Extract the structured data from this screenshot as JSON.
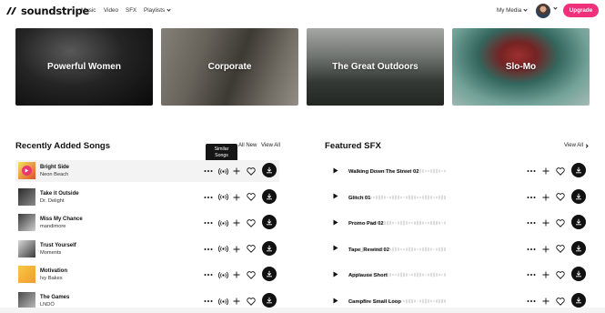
{
  "nav": {
    "brand": "soundstripe",
    "links": [
      "Music",
      "Video",
      "SFX",
      "Playlists"
    ],
    "my_media": "My Media",
    "upgrade": "Upgrade"
  },
  "banners": [
    "Powerful Women",
    "Corporate",
    "The Great Outdoors",
    "Slo-Mo"
  ],
  "recent": {
    "title": "Recently Added Songs",
    "all_new": "All New",
    "view_all": "View All",
    "tooltip": [
      "Similar",
      "Songs"
    ],
    "songs": [
      {
        "title": "Bright Side",
        "artist": "Neon Beach"
      },
      {
        "title": "Take it Outside",
        "artist": "Dr. Delight"
      },
      {
        "title": "Miss My Chance",
        "artist": "mandimore"
      },
      {
        "title": "Trust Yourself",
        "artist": "Moments"
      },
      {
        "title": "Motivation",
        "artist": "Ivy Bakes"
      },
      {
        "title": "The Games",
        "artist": "LNDÖ"
      }
    ]
  },
  "sfx": {
    "title": "Featured SFX",
    "view_all": "View All",
    "items": [
      {
        "title": "Walking Down The Street 02"
      },
      {
        "title": "Glitch 01"
      },
      {
        "title": "Promo Pad 02"
      },
      {
        "title": "Tape_Rewind 02"
      },
      {
        "title": "Applause Short"
      },
      {
        "title": "Campfire Small Loop"
      }
    ]
  },
  "colors": {
    "accent": "#f0307a",
    "dark": "#111111",
    "tooltip_bg": "#161616"
  },
  "icons": [
    "more-icon",
    "similar-songs-icon",
    "plus-icon",
    "heart-icon",
    "download-icon",
    "play-icon",
    "chevron-right-icon",
    "chevron-down-icon"
  ]
}
